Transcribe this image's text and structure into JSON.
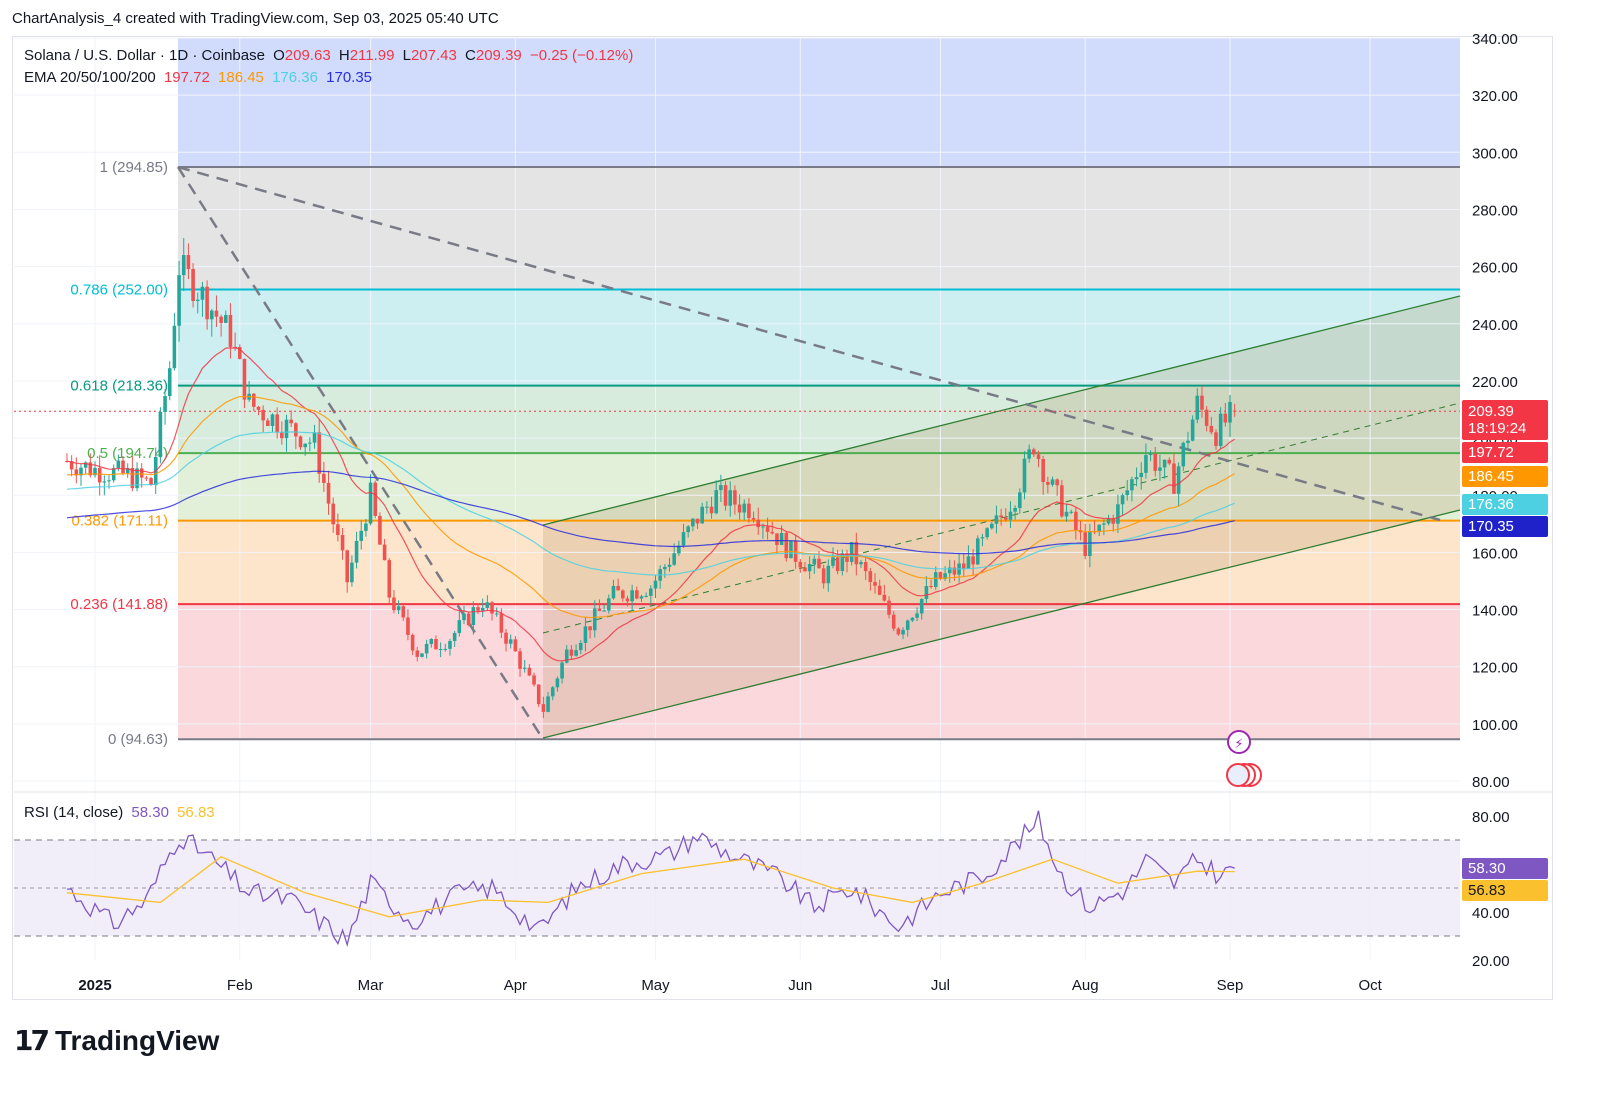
{
  "header": {
    "text": "ChartAnalysis_4 created with TradingView.com, Sep 03, 2025 05:40 UTC"
  },
  "legend": {
    "symbol": "Solana / U.S. Dollar · 1D · Coinbase",
    "o_label": "O",
    "o": "209.63",
    "h_label": "H",
    "h": "211.99",
    "l_label": "L",
    "l": "207.43",
    "c_label": "C",
    "c": "209.39",
    "change": "−0.25 (−0.12%)",
    "ema_label": "EMA 20/50/100/200",
    "ema20": "197.72",
    "ema50": "186.45",
    "ema100": "176.36",
    "ema200": "170.35",
    "rsi_label": "RSI (14, close)",
    "rsi": "58.30",
    "rsi_ma": "56.83"
  },
  "price_tags": {
    "last": "209.39",
    "countdown": "18:19:24",
    "ema20": "197.72",
    "ema50": "186.45",
    "ema100": "176.36",
    "ema200": "170.35",
    "rsi": "58.30",
    "rsi_ma": "56.83"
  },
  "colors": {
    "up": "#26a69a",
    "down": "#ef5350",
    "ema20": "#f23645",
    "ema50": "#ff9800",
    "ema100": "#4dd0e1",
    "ema200": "#2a2edb",
    "rsi": "#7e57c2",
    "rsi_ma": "#fbc02d",
    "fib0": "#787b86",
    "fib236": "#f23645",
    "fib382": "#ff9800",
    "fib5": "#4caf50",
    "fib618": "#089981",
    "fib786": "#00bcd4",
    "fib1": "#787b86"
  },
  "footer": {
    "brand": "TradingView",
    "mark": "17"
  },
  "chart_data": [
    {
      "type": "candlestick",
      "title": "Solana / U.S. Dollar · 1D · Coinbase",
      "x": [
        "Jan 01",
        "Feb 01",
        "Mar 01",
        "Apr 01",
        "May 01",
        "Jun 01",
        "Jul 01",
        "Aug 01",
        "Sep 01",
        "Oct 01"
      ],
      "x_tick_labels": [
        "2025",
        "Feb",
        "Mar",
        "Apr",
        "May",
        "Jun",
        "Jul",
        "Aug",
        "Sep",
        "Oct"
      ],
      "ylim": [
        80,
        340
      ],
      "y_ticks": [
        "80.00",
        "100.00",
        "120.00",
        "140.00",
        "160.00",
        "180.00",
        "200.00",
        "220.00",
        "240.00",
        "260.00",
        "280.00",
        "300.00",
        "320.00",
        "340.00"
      ],
      "close_path": [
        [
          "2024-12-26",
          192
        ],
        [
          "2025-01-01",
          189
        ],
        [
          "2025-01-08",
          187
        ],
        [
          "2025-01-13",
          184
        ],
        [
          "2025-01-17",
          225
        ],
        [
          "2025-01-19",
          260
        ],
        [
          "2025-01-24",
          250
        ],
        [
          "2025-01-30",
          236
        ],
        [
          "2025-02-03",
          212
        ],
        [
          "2025-02-10",
          205
        ],
        [
          "2025-02-17",
          198
        ],
        [
          "2025-02-24",
          150
        ],
        [
          "2025-03-01",
          180
        ],
        [
          "2025-03-05",
          145
        ],
        [
          "2025-03-11",
          125
        ],
        [
          "2025-03-18",
          130
        ],
        [
          "2025-03-25",
          143
        ],
        [
          "2025-03-31",
          128
        ],
        [
          "2025-04-07",
          105
        ],
        [
          "2025-04-12",
          125
        ],
        [
          "2025-04-22",
          145
        ],
        [
          "2025-04-30",
          148
        ],
        [
          "2025-05-10",
          172
        ],
        [
          "2025-05-14",
          180
        ],
        [
          "2025-05-22",
          175
        ],
        [
          "2025-05-30",
          160
        ],
        [
          "2025-06-06",
          152
        ],
        [
          "2025-06-12",
          160
        ],
        [
          "2025-06-22",
          133
        ],
        [
          "2025-06-30",
          150
        ],
        [
          "2025-07-06",
          155
        ],
        [
          "2025-07-11",
          165
        ],
        [
          "2025-07-17",
          180
        ],
        [
          "2025-07-21",
          198
        ],
        [
          "2025-07-24",
          185
        ],
        [
          "2025-08-01",
          162
        ],
        [
          "2025-08-08",
          175
        ],
        [
          "2025-08-14",
          195
        ],
        [
          "2025-08-20",
          185
        ],
        [
          "2025-08-25",
          212
        ],
        [
          "2025-08-29",
          202
        ],
        [
          "2025-09-02",
          209.39
        ]
      ],
      "last": {
        "open": 209.63,
        "high": 211.99,
        "low": 207.43,
        "close": 209.39,
        "change": -0.25,
        "change_pct": -0.12
      },
      "ema": {
        "ema20": 197.72,
        "ema50": 186.45,
        "ema100": 176.36,
        "ema200": 170.35
      }
    },
    {
      "type": "fibonacci",
      "levels": [
        {
          "ratio": "1",
          "value": 294.85,
          "label": "1 (294.85)"
        },
        {
          "ratio": "0.786",
          "value": 252.0,
          "label": "0.786 (252.00)"
        },
        {
          "ratio": "0.618",
          "value": 218.36,
          "label": "0.618 (218.36)"
        },
        {
          "ratio": "0.5",
          "value": 194.74,
          "label": "0.5 (194.74)"
        },
        {
          "ratio": "0.382",
          "value": 171.11,
          "label": "0.382 (171.11)"
        },
        {
          "ratio": "0.236",
          "value": 141.88,
          "label": "0.236 (141.88)"
        },
        {
          "ratio": "0",
          "value": 94.63,
          "label": "0 (94.63)"
        }
      ]
    },
    {
      "type": "line",
      "title": "RSI (14, close)",
      "ylim": [
        20,
        80
      ],
      "y_ticks": [
        "20.00",
        "40.00",
        "80.00"
      ],
      "bands": [
        30,
        70
      ],
      "series": [
        {
          "name": "RSI",
          "last": 58.3,
          "values": [
            [
              "2024-12-26",
              50
            ],
            [
              "2025-01-05",
              35
            ],
            [
              "2025-01-12",
              45
            ],
            [
              "2025-01-19",
              72
            ],
            [
              "2025-01-26",
              62
            ],
            [
              "2025-02-03",
              48
            ],
            [
              "2025-02-12",
              45
            ],
            [
              "2025-02-24",
              28
            ],
            [
              "2025-03-01",
              52
            ],
            [
              "2025-03-10",
              36
            ],
            [
              "2025-03-20",
              48
            ],
            [
              "2025-03-27",
              50
            ],
            [
              "2025-04-06",
              32
            ],
            [
              "2025-04-14",
              50
            ],
            [
              "2025-04-24",
              60
            ],
            [
              "2025-05-04",
              64
            ],
            [
              "2025-05-10",
              72
            ],
            [
              "2025-05-16",
              65
            ],
            [
              "2025-05-27",
              55
            ],
            [
              "2025-06-04",
              42
            ],
            [
              "2025-06-12",
              50
            ],
            [
              "2025-06-22",
              34
            ],
            [
              "2025-07-01",
              48
            ],
            [
              "2025-07-10",
              55
            ],
            [
              "2025-07-17",
              68
            ],
            [
              "2025-07-22",
              78
            ],
            [
              "2025-07-27",
              55
            ],
            [
              "2025-08-02",
              42
            ],
            [
              "2025-08-10",
              50
            ],
            [
              "2025-08-14",
              62
            ],
            [
              "2025-08-20",
              52
            ],
            [
              "2025-08-25",
              62
            ],
            [
              "2025-08-30",
              55
            ],
            [
              "2025-09-02",
              58.3
            ]
          ]
        },
        {
          "name": "RSI MA",
          "last": 56.83,
          "values": [
            [
              "2024-12-26",
              48
            ],
            [
              "2025-01-15",
              44
            ],
            [
              "2025-01-28",
              63
            ],
            [
              "2025-02-15",
              48
            ],
            [
              "2025-03-05",
              38
            ],
            [
              "2025-03-25",
              45
            ],
            [
              "2025-04-08",
              44
            ],
            [
              "2025-04-28",
              56
            ],
            [
              "2025-05-20",
              62
            ],
            [
              "2025-06-08",
              50
            ],
            [
              "2025-06-25",
              44
            ],
            [
              "2025-07-10",
              52
            ],
            [
              "2025-07-25",
              62
            ],
            [
              "2025-08-08",
              52
            ],
            [
              "2025-08-25",
              57
            ],
            [
              "2025-09-02",
              56.83
            ]
          ]
        }
      ]
    }
  ]
}
